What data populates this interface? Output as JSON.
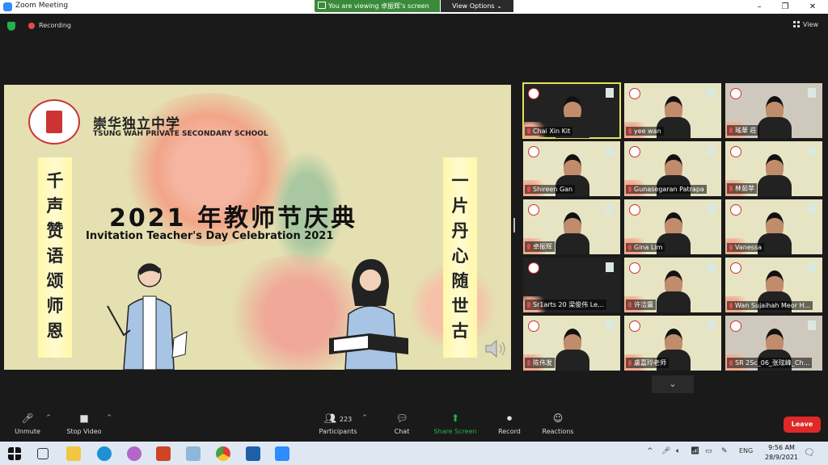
{
  "window": {
    "title": "Zoom Meeting",
    "minimize": "–",
    "maximize": "❐",
    "close": "✕"
  },
  "banner": {
    "viewing": "You are viewing 卓振辉's screen",
    "view_options": "View Options ⌄"
  },
  "status": {
    "recording": "Recording",
    "view": "View"
  },
  "slide": {
    "school_cn": "崇华独立中学",
    "school_en": "TSUNG WAH PRIVATE SECONDARY SCHOOL",
    "title": "2021 年教师节庆典",
    "subtitle": "Invitation Teacher's Day Celebration 2021",
    "scroll_left": "千\n声\n赞\n语\n颂\n师\n恩",
    "scroll_right": "一\n片\n丹\n心\n随\n世\n古"
  },
  "participants": [
    {
      "name": "Chai Xin Kit"
    },
    {
      "name": "yee wan"
    },
    {
      "name": "瑤華 莊"
    },
    {
      "name": "Shireen Gan"
    },
    {
      "name": "Gunasegaran Patrapa"
    },
    {
      "name": "林茹苹"
    },
    {
      "name": "卓振辉"
    },
    {
      "name": "Gina Lim"
    },
    {
      "name": "Vanessa"
    },
    {
      "name": "Sr1arts  20 梁俊伟 Le..."
    },
    {
      "name": "许洁霙"
    },
    {
      "name": "Wan Sujaihah Meor H..."
    },
    {
      "name": "陈伟发"
    },
    {
      "name": "盧嘉玲老师"
    },
    {
      "name": "SR 2Sc_06_张玹峰_Ch..."
    }
  ],
  "toolbar": {
    "unmute": "Unmute",
    "stop_video": "Stop Video",
    "participants": "Participants",
    "participants_count": "223",
    "chat": "Chat",
    "share_screen": "Share Screen",
    "record": "Record",
    "reactions": "Reactions",
    "leave": "Leave"
  },
  "taskbar": {
    "lang": "ENG",
    "time": "9:56 AM",
    "date": "28/9/2021"
  },
  "colors": {
    "share_green": "#23b14d",
    "leave_red": "#e02828",
    "active_tile": "#e4e25a"
  }
}
